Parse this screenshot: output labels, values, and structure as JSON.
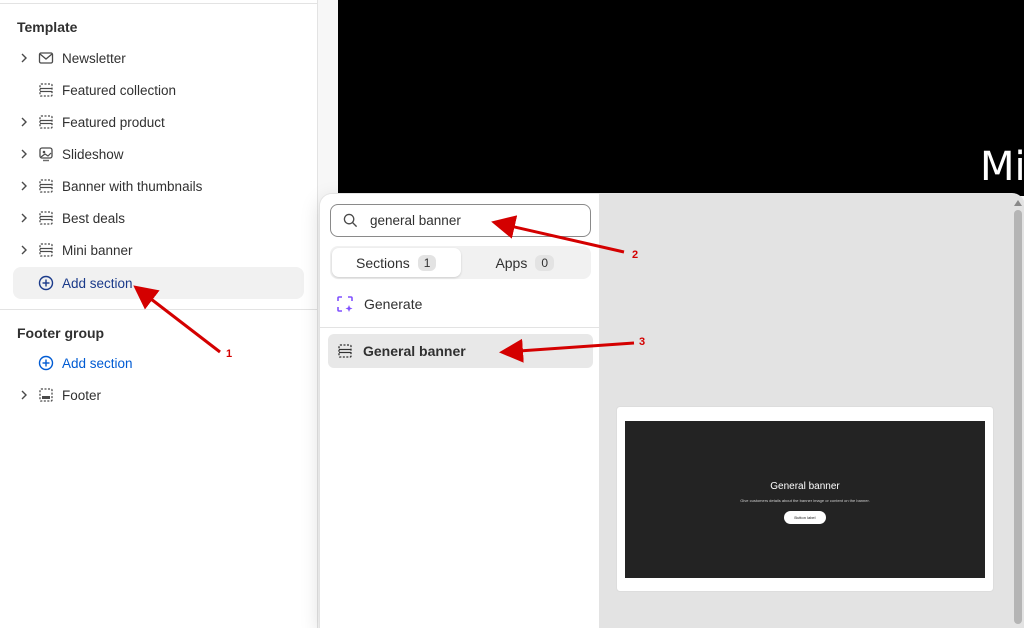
{
  "sidebar": {
    "template_title": "Template",
    "template_items": [
      {
        "label": "Newsletter",
        "icon": "mail-icon",
        "expandable": true
      },
      {
        "label": "Featured collection",
        "icon": "section-icon",
        "expandable": false
      },
      {
        "label": "Featured product",
        "icon": "section-icon",
        "expandable": true
      },
      {
        "label": "Slideshow",
        "icon": "slideshow-icon",
        "expandable": true
      },
      {
        "label": "Banner with thumbnails",
        "icon": "section-icon",
        "expandable": true
      },
      {
        "label": "Best deals",
        "icon": "section-icon",
        "expandable": true
      },
      {
        "label": "Mini banner",
        "icon": "section-icon",
        "expandable": true
      }
    ],
    "template_add_label": "Add section",
    "footer_title": "Footer group",
    "footer_add_label": "Add section",
    "footer_items": [
      {
        "label": "Footer",
        "icon": "footer-icon",
        "expandable": true
      }
    ]
  },
  "preview": {
    "heading_fragment": "Mi"
  },
  "popover": {
    "search_value": "general banner",
    "tabs": [
      {
        "label": "Sections",
        "count": "1",
        "active": true
      },
      {
        "label": "Apps",
        "count": "0",
        "active": false
      }
    ],
    "generate_label": "Generate",
    "results": [
      {
        "label": "General banner",
        "icon": "section-icon"
      }
    ],
    "preview_card": {
      "title": "General banner",
      "description": "Give customers details about the banner image or content on the banner.",
      "button_label": "Button label"
    }
  },
  "annotations": [
    {
      "number": "1"
    },
    {
      "number": "2"
    },
    {
      "number": "3"
    }
  ],
  "colors": {
    "accent_blue": "#005bd3",
    "annotation_red": "#d40000",
    "generate_purple": "#8051ff"
  }
}
